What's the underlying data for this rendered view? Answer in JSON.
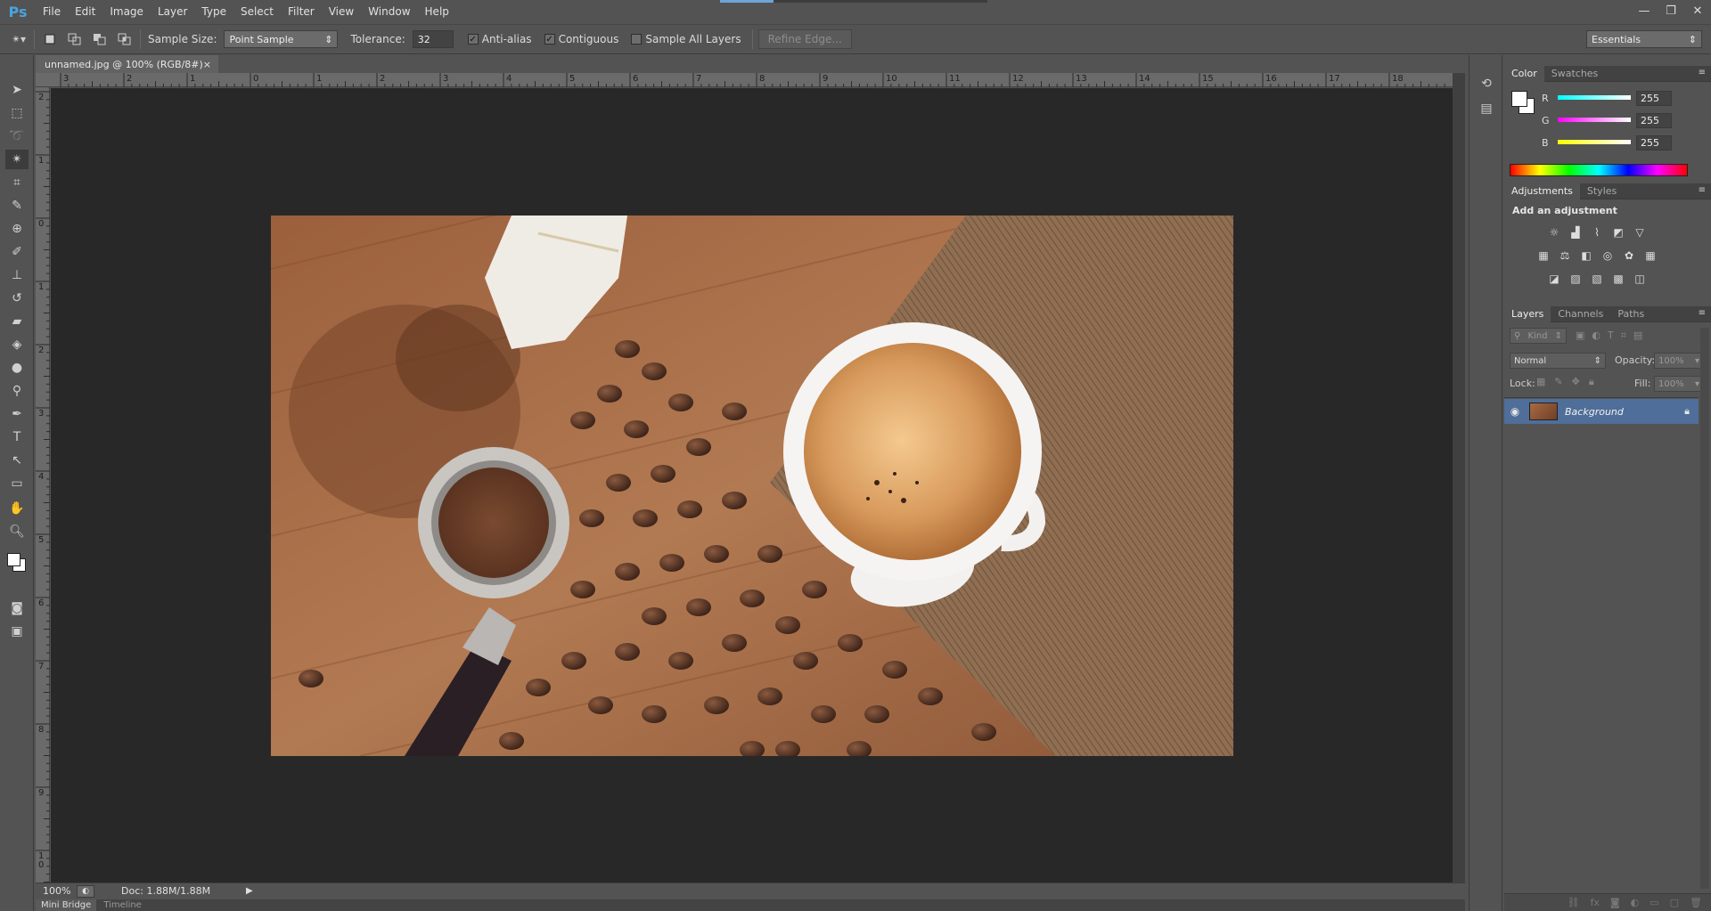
{
  "app": {
    "logo": "Ps"
  },
  "menu": [
    "File",
    "Edit",
    "Image",
    "Layer",
    "Type",
    "Select",
    "Filter",
    "View",
    "Window",
    "Help"
  ],
  "window_controls": {
    "minimize": "—",
    "restore": "❐",
    "close": "✕"
  },
  "options": {
    "sample_size_label": "Sample Size:",
    "sample_size_value": "Point Sample",
    "tolerance_label": "Tolerance:",
    "tolerance_value": "32",
    "anti_alias_label": "Anti-alias",
    "anti_alias_checked": true,
    "contiguous_label": "Contiguous",
    "contiguous_checked": true,
    "sample_all_layers_label": "Sample All Layers",
    "sample_all_layers_checked": false,
    "refine_edge_label": "Refine Edge...",
    "workspace": "Essentials"
  },
  "document": {
    "tab_title": "unnamed.jpg @ 100% (RGB/8#)",
    "tab_close": "×",
    "zoom": "100%",
    "doc_info": "Doc: 1.88M/1.88M",
    "h_ruler": [
      "3",
      "2",
      "1",
      "0",
      "1",
      "2",
      "3",
      "4",
      "5",
      "6",
      "7",
      "8",
      "9",
      "10",
      "11",
      "12",
      "13",
      "14",
      "15",
      "16",
      "17",
      "18"
    ],
    "v_ruler": [
      "2",
      "1",
      "0",
      "1",
      "2",
      "3",
      "4",
      "5",
      "6",
      "7",
      "8",
      "9",
      "1\n0"
    ]
  },
  "bottom_tabs": [
    "Mini Bridge",
    "Timeline"
  ],
  "color_panel": {
    "tabs": [
      "Color",
      "Swatches"
    ],
    "channels": [
      {
        "label": "R",
        "value": "255"
      },
      {
        "label": "G",
        "value": "255"
      },
      {
        "label": "B",
        "value": "255"
      }
    ]
  },
  "adjustments_panel": {
    "tabs": [
      "Adjustments",
      "Styles"
    ],
    "title": "Add an adjustment"
  },
  "layers_panel": {
    "tabs": [
      "Layers",
      "Channels",
      "Paths"
    ],
    "kind_label": "Kind",
    "blend_mode": "Normal",
    "opacity_label": "Opacity:",
    "opacity_value": "100%",
    "lock_label": "Lock:",
    "fill_label": "Fill:",
    "fill_value": "100%",
    "layers": [
      {
        "name": "Background",
        "visible": true,
        "locked": true
      }
    ]
  },
  "colors": {
    "accent": "#4aa3df",
    "selected_layer": "#4f6e99",
    "canvas_bg": "#282828"
  }
}
